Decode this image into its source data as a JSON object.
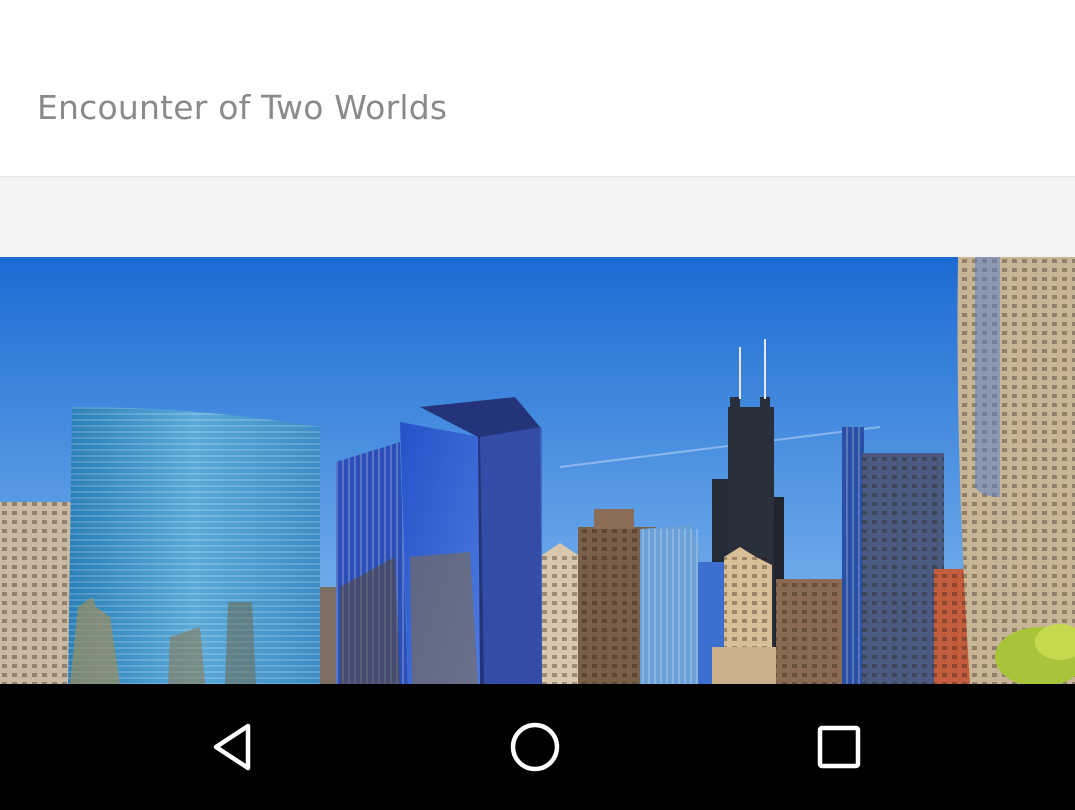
{
  "header": {
    "title": "Encounter of Two Worlds"
  },
  "hero": {
    "icon": "city-skyline-image",
    "colors": {
      "sky_top": "#1f6fd6",
      "sky_bottom": "#7fb6ee"
    }
  },
  "navigation_bar": {
    "background": "#000000",
    "buttons": [
      {
        "icon": "back-triangle-icon"
      },
      {
        "icon": "home-circle-icon"
      },
      {
        "icon": "recents-square-icon"
      }
    ]
  }
}
